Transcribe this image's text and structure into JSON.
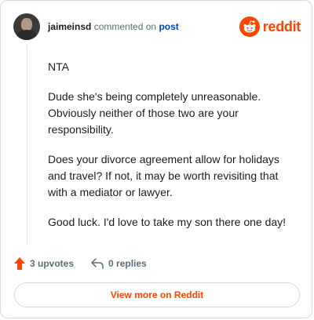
{
  "header": {
    "username": "jaimeinsd",
    "action_text": "commented on",
    "post_link": "post",
    "brand": "reddit"
  },
  "comment": {
    "paragraphs": [
      "NTA",
      "Dude she's being completely unreasonable. Obviously neither of those two are your responsibility.",
      "Does your divorce agreement allow for holidays and travel? If not, it may be worth revisiting that with a mediator or lawyer.",
      "Good luck. I'd love to take my son there one day!"
    ]
  },
  "actions": {
    "upvotes": "3 upvotes",
    "replies": "0 replies"
  },
  "footer": {
    "view_more": "View more on Reddit"
  },
  "colors": {
    "brand": "#ff4500",
    "link": "#0045ac",
    "muted": "#576f76"
  },
  "icons": [
    "avatar",
    "reddit-logo-icon",
    "upvote-arrow-icon",
    "reply-icon"
  ]
}
